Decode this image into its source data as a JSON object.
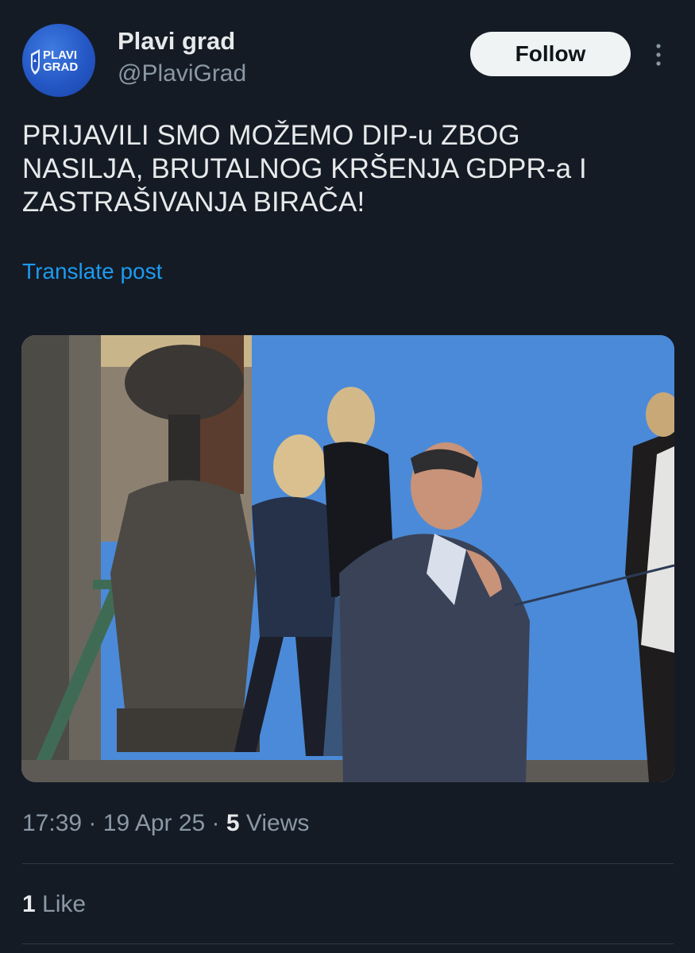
{
  "account": {
    "display_name": "Plavi grad",
    "handle": "@PlaviGrad",
    "avatar_logo_text": [
      "PLAVI",
      "GRAD"
    ],
    "brand_color": "#2457c5"
  },
  "header": {
    "follow_label": "Follow",
    "more_icon": "more-vertical-icon"
  },
  "tweet": {
    "text_lines": [
      "PRIJAVILI SMO MOŽEMO DIP-u ZBOG",
      "NASILJA, BRUTALNOG KRŠENJA GDPR-a I",
      "ZASTRAŠIVANJA BIRAČA!"
    ],
    "translate_label": "Translate post",
    "translate_color": "#1d9bf0"
  },
  "meta": {
    "time": "17:39",
    "date": "19 Apr 25",
    "separator": "·",
    "views_count": "5",
    "views_label": "Views"
  },
  "engagement": {
    "likes_count": "1",
    "likes_label": "Like"
  },
  "theme": {
    "background": "#141b25",
    "text": "#e7e9ea",
    "muted": "#8b98a5"
  }
}
